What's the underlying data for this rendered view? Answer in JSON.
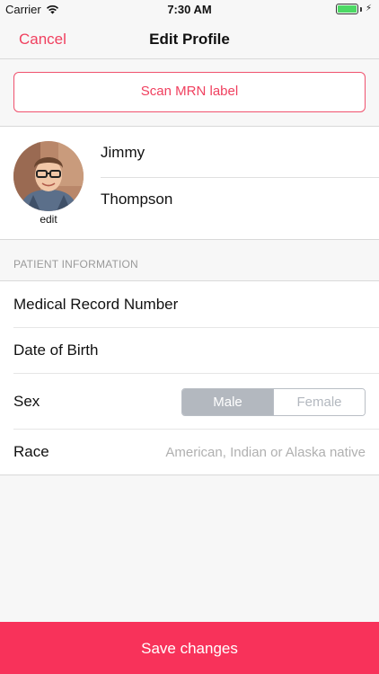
{
  "status_bar": {
    "carrier": "Carrier",
    "time": "7:30 AM",
    "battery_color": "#4cd964"
  },
  "nav": {
    "cancel_label": "Cancel",
    "title": "Edit Profile"
  },
  "scan": {
    "button_label": "Scan MRN label"
  },
  "profile": {
    "avatar_edit_label": "edit",
    "first_name": "Jimmy",
    "last_name": "Thompson"
  },
  "section": {
    "header": "PATIENT INFORMATION"
  },
  "fields": {
    "mrn_label": "Medical Record Number",
    "dob_label": "Date of Birth",
    "sex_label": "Sex",
    "sex_options": [
      "Male",
      "Female"
    ],
    "sex_selected": "Male",
    "race_label": "Race",
    "race_value": "American, Indian or Alaska native"
  },
  "footer": {
    "save_label": "Save changes"
  },
  "colors": {
    "accent": "#f0405f",
    "save_bar": "#f8325a",
    "segment_selected": "#b3b8bf"
  }
}
